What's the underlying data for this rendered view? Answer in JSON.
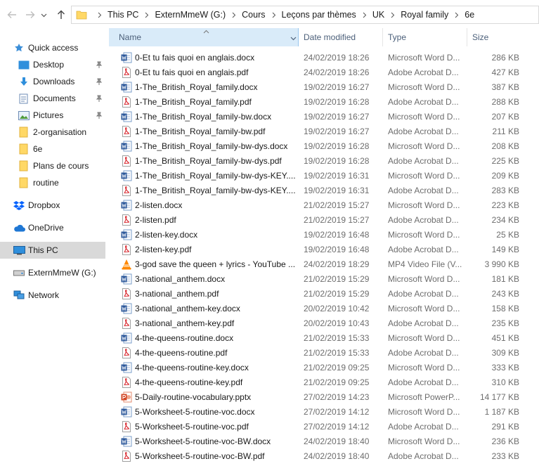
{
  "address": {
    "crumbs": [
      "This PC",
      "ExternMmeW (G:)",
      "Cours",
      "Leçons par thèmes",
      "UK",
      "Royal family",
      "6e"
    ]
  },
  "columns": {
    "name": "Name",
    "date": "Date modified",
    "type": "Type",
    "size": "Size"
  },
  "nav": {
    "quick_access": "Quick access",
    "desktop": "Desktop",
    "downloads": "Downloads",
    "documents": "Documents",
    "pictures": "Pictures",
    "f_organisation": "2-organisation",
    "f_6e": "6e",
    "f_plans": "Plans de cours",
    "f_routine": "routine",
    "dropbox": "Dropbox",
    "onedrive": "OneDrive",
    "thispc": "This PC",
    "drive": "ExternMmeW (G:)",
    "network": "Network"
  },
  "files": [
    {
      "icon": "word",
      "name": "0-Et tu fais quoi en anglais.docx",
      "date": "24/02/2019 18:26",
      "type": "Microsoft Word D...",
      "size": "286 KB"
    },
    {
      "icon": "pdf",
      "name": "0-Et tu fais quoi en anglais.pdf",
      "date": "24/02/2019 18:26",
      "type": "Adobe Acrobat D...",
      "size": "427 KB"
    },
    {
      "icon": "word",
      "name": "1-The_British_Royal_family.docx",
      "date": "19/02/2019 16:27",
      "type": "Microsoft Word D...",
      "size": "387 KB"
    },
    {
      "icon": "pdf",
      "name": "1-The_British_Royal_family.pdf",
      "date": "19/02/2019 16:28",
      "type": "Adobe Acrobat D...",
      "size": "288 KB"
    },
    {
      "icon": "word",
      "name": "1-The_British_Royal_family-bw.docx",
      "date": "19/02/2019 16:27",
      "type": "Microsoft Word D...",
      "size": "207 KB"
    },
    {
      "icon": "pdf",
      "name": "1-The_British_Royal_family-bw.pdf",
      "date": "19/02/2019 16:27",
      "type": "Adobe Acrobat D...",
      "size": "211 KB"
    },
    {
      "icon": "word",
      "name": "1-The_British_Royal_family-bw-dys.docx",
      "date": "19/02/2019 16:28",
      "type": "Microsoft Word D...",
      "size": "208 KB"
    },
    {
      "icon": "pdf",
      "name": "1-The_British_Royal_family-bw-dys.pdf",
      "date": "19/02/2019 16:28",
      "type": "Adobe Acrobat D...",
      "size": "225 KB"
    },
    {
      "icon": "word",
      "name": "1-The_British_Royal_family-bw-dys-KEY....",
      "date": "19/02/2019 16:31",
      "type": "Microsoft Word D...",
      "size": "209 KB"
    },
    {
      "icon": "pdf",
      "name": "1-The_British_Royal_family-bw-dys-KEY....",
      "date": "19/02/2019 16:31",
      "type": "Adobe Acrobat D...",
      "size": "283 KB"
    },
    {
      "icon": "word",
      "name": "2-listen.docx",
      "date": "21/02/2019 15:27",
      "type": "Microsoft Word D...",
      "size": "223 KB"
    },
    {
      "icon": "pdf",
      "name": "2-listen.pdf",
      "date": "21/02/2019 15:27",
      "type": "Adobe Acrobat D...",
      "size": "234 KB"
    },
    {
      "icon": "word",
      "name": "2-listen-key.docx",
      "date": "19/02/2019 16:48",
      "type": "Microsoft Word D...",
      "size": "25 KB"
    },
    {
      "icon": "pdf",
      "name": "2-listen-key.pdf",
      "date": "19/02/2019 16:48",
      "type": "Adobe Acrobat D...",
      "size": "149 KB"
    },
    {
      "icon": "vlc",
      "name": "3-god save the queen + lyrics - YouTube ...",
      "date": "24/02/2019 18:29",
      "type": "MP4 Video File (V...",
      "size": "3 990 KB"
    },
    {
      "icon": "word",
      "name": "3-national_anthem.docx",
      "date": "21/02/2019 15:29",
      "type": "Microsoft Word D...",
      "size": "181 KB"
    },
    {
      "icon": "pdf",
      "name": "3-national_anthem.pdf",
      "date": "21/02/2019 15:29",
      "type": "Adobe Acrobat D...",
      "size": "243 KB"
    },
    {
      "icon": "word",
      "name": "3-national_anthem-key.docx",
      "date": "20/02/2019 10:42",
      "type": "Microsoft Word D...",
      "size": "158 KB"
    },
    {
      "icon": "pdf",
      "name": "3-national_anthem-key.pdf",
      "date": "20/02/2019 10:43",
      "type": "Adobe Acrobat D...",
      "size": "235 KB"
    },
    {
      "icon": "word",
      "name": "4-the-queens-routine.docx",
      "date": "21/02/2019 15:33",
      "type": "Microsoft Word D...",
      "size": "451 KB"
    },
    {
      "icon": "pdf",
      "name": "4-the-queens-routine.pdf",
      "date": "21/02/2019 15:33",
      "type": "Adobe Acrobat D...",
      "size": "309 KB"
    },
    {
      "icon": "word",
      "name": "4-the-queens-routine-key.docx",
      "date": "21/02/2019 09:25",
      "type": "Microsoft Word D...",
      "size": "333 KB"
    },
    {
      "icon": "pdf",
      "name": "4-the-queens-routine-key.pdf",
      "date": "21/02/2019 09:25",
      "type": "Adobe Acrobat D...",
      "size": "310 KB"
    },
    {
      "icon": "ppt",
      "name": "5-Daily-routine-vocabulary.pptx",
      "date": "27/02/2019 14:23",
      "type": "Microsoft PowerP...",
      "size": "14 177 KB"
    },
    {
      "icon": "word",
      "name": "5-Worksheet-5-routine-voc.docx",
      "date": "27/02/2019 14:12",
      "type": "Microsoft Word D...",
      "size": "1 187 KB"
    },
    {
      "icon": "pdf",
      "name": "5-Worksheet-5-routine-voc.pdf",
      "date": "27/02/2019 14:12",
      "type": "Adobe Acrobat D...",
      "size": "291 KB"
    },
    {
      "icon": "word",
      "name": "5-Worksheet-5-routine-voc-BW.docx",
      "date": "24/02/2019 18:40",
      "type": "Microsoft Word D...",
      "size": "236 KB"
    },
    {
      "icon": "pdf",
      "name": "5-Worksheet-5-routine-voc-BW.pdf",
      "date": "24/02/2019 18:40",
      "type": "Adobe Acrobat D...",
      "size": "233 KB"
    }
  ],
  "colors": {
    "selected_nav": "#d9d9d9",
    "header_active": "#d9ebf9",
    "word_blue": "#2b579a",
    "pdf_red": "#d9282f",
    "ppt_orange": "#d24726",
    "folder_yellow": "#ffd866"
  }
}
